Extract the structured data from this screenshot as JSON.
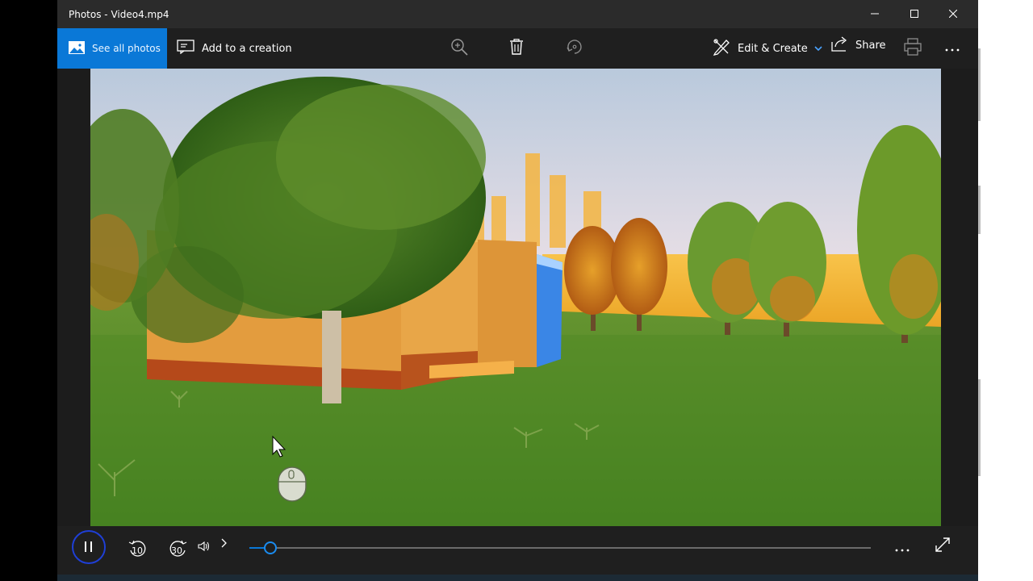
{
  "window": {
    "title": "Photos - Video4.mp4",
    "controls": {
      "minimize_icon": "minimize-icon",
      "maximize_icon": "maximize-icon",
      "close_icon": "close-icon"
    }
  },
  "toolbar": {
    "see_all_photos": "See all photos",
    "add_to_creation": "Add to a creation",
    "edit_create": "Edit & Create",
    "share": "Share",
    "icons": [
      "photos-icon",
      "add-creation-icon",
      "zoom-icon",
      "delete-icon",
      "rotate-icon",
      "edit-icon",
      "chevron-down-icon",
      "share-icon",
      "print-icon",
      "more-icon"
    ]
  },
  "player": {
    "skip_back_label": "10",
    "skip_forward_label": "30",
    "state": "playing",
    "progress": 0.034,
    "icons": [
      "pause-icon",
      "skip-back-10-icon",
      "skip-forward-30-icon",
      "volume-icon",
      "expand-chevron-icon",
      "more-icon",
      "fullscreen-icon"
    ]
  },
  "colors": {
    "accent": "#0a78d7",
    "window_bg": "#1f1f1f",
    "titlebar_bg": "#2b2b2b"
  }
}
